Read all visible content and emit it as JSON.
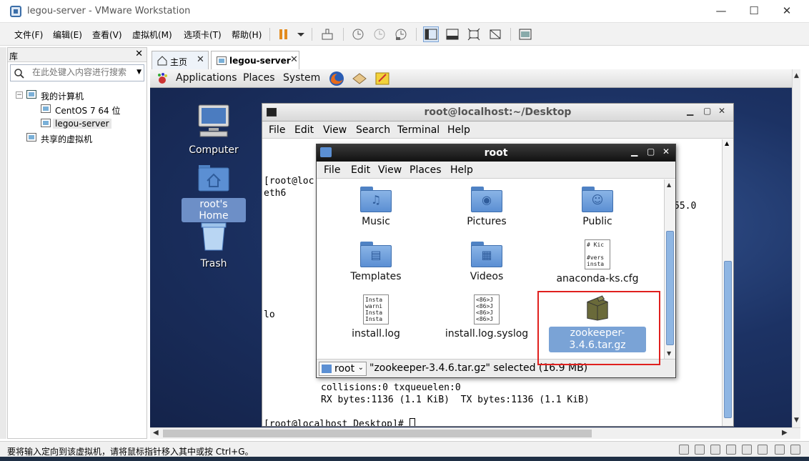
{
  "window": {
    "title": "legou-server - VMware Workstation",
    "minimize": "—",
    "maximize": "☐",
    "close": "✕"
  },
  "menu": [
    "文件(F)",
    "编辑(E)",
    "查看(V)",
    "虚拟机(M)",
    "选项卡(T)",
    "帮助(H)"
  ],
  "library": {
    "title": "库",
    "close": "✕",
    "search_placeholder": "在此处键入内容进行搜索",
    "tree": {
      "root": "我的计算机",
      "items": [
        "CentOS 7 64 位",
        "legou-server"
      ],
      "shared": "共享的虚拟机"
    }
  },
  "tabs": [
    {
      "label": "主页",
      "close": "✕"
    },
    {
      "label": "legou-server",
      "close": "✕"
    }
  ],
  "gnome_panel": {
    "menus": [
      "Applications",
      "Places",
      "System"
    ]
  },
  "desktop_icons": [
    {
      "label": "Computer"
    },
    {
      "label": "root's Home"
    },
    {
      "label": "Trash"
    }
  ],
  "terminal": {
    "title": "root@localhost:~/Desktop",
    "menu": [
      "File",
      "Edit",
      "View",
      "Search",
      "Terminal",
      "Help"
    ],
    "lines": [
      "[root@loc",
      "eth6",
      "55.0",
      "lo",
      "collisions:0 txqueuelen:0",
      "RX bytes:1136 (1.1 KiB)  TX bytes:1136 (1.1 KiB)",
      "[root@localhost Desktop]# "
    ]
  },
  "file_manager": {
    "title": "root",
    "menu": [
      "File",
      "Edit",
      "View",
      "Places",
      "Help"
    ],
    "items": [
      {
        "label": "Music",
        "glyph": "♫"
      },
      {
        "label": "Pictures",
        "glyph": "◉"
      },
      {
        "label": "Public",
        "glyph": "☺"
      },
      {
        "label": "Templates",
        "glyph": "▤"
      },
      {
        "label": "Videos",
        "glyph": "▦"
      },
      {
        "label": "anaconda-ks.cfg",
        "preview": "# Kic\n\n#vers\ninsta"
      },
      {
        "label": "install.log",
        "preview": "Insta\nwarni\nInsta\nInsta"
      },
      {
        "label": "install.log.syslog",
        "preview": "<86>J\n<86>J\n<86>J\n<86>J"
      },
      {
        "label": "zookeeper-3.4.6.tar.gz"
      }
    ],
    "location": "root",
    "status": "\"zookeeper-3.4.6.tar.gz\" selected (16.9 MB)"
  },
  "statusbar": {
    "message": "要将输入定向到该虚拟机，请将鼠标指针移入其中或按 Ctrl+G。"
  }
}
